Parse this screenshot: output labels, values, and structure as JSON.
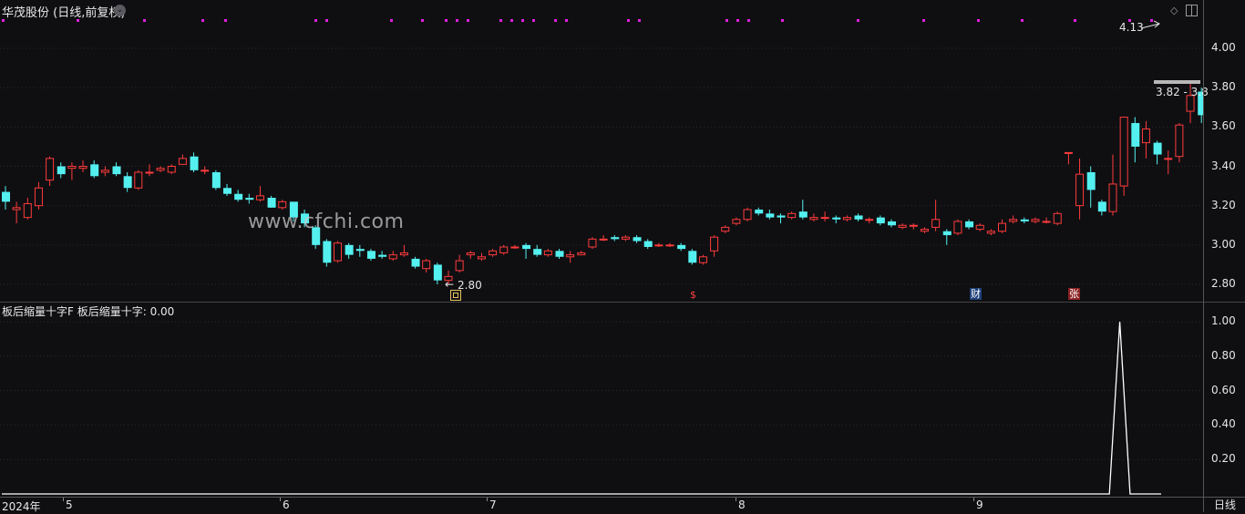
{
  "header": {
    "title": "华茂股份 (日线,前复权)",
    "dropdown_icon": "chevron-down-icon",
    "settings_icon": "diamond-icon",
    "maximize_icon": "maximize-icon"
  },
  "price_axis": {
    "ticks": [
      "4.00",
      "3.80",
      "3.60",
      "3.40",
      "3.20",
      "3.00",
      "2.80"
    ]
  },
  "indicator": {
    "title": "板后缩量十字F  板后缩量十字: 0.00",
    "axis_ticks": [
      "1.00",
      "0.80",
      "0.60",
      "0.40",
      "0.20"
    ]
  },
  "x_axis": {
    "labels": [
      "2024年",
      "5",
      "6",
      "7",
      "8",
      "9"
    ]
  },
  "period_label": "日线",
  "watermark": "www.cfchi.com",
  "annotations": {
    "high_label": "4.13",
    "low_label": "2.80",
    "range_label": "3.82 - 3.8",
    "marker_s": "$",
    "marker_cai": "财",
    "marker_zhang": "张"
  },
  "colors": {
    "up": "#ff3b3b",
    "down": "#54f0f0",
    "dots": "#e020e0",
    "background": "#0f0f12"
  },
  "chart_data": [
    {
      "type": "candlestick",
      "ylim": [
        2.74,
        4.18
      ],
      "ticks": [
        4.0,
        3.8,
        3.6,
        3.4,
        3.2,
        3.0,
        2.8
      ],
      "candles": [
        [
          3.27,
          3.22,
          3.3,
          3.18
        ],
        [
          3.18,
          3.19,
          3.22,
          3.11
        ],
        [
          3.14,
          3.21,
          3.24,
          3.13
        ],
        [
          3.2,
          3.29,
          3.32,
          3.18
        ],
        [
          3.33,
          3.44,
          3.45,
          3.3
        ],
        [
          3.4,
          3.36,
          3.42,
          3.34
        ],
        [
          3.39,
          3.4,
          3.42,
          3.33
        ],
        [
          3.39,
          3.4,
          3.43,
          3.37
        ],
        [
          3.41,
          3.35,
          3.43,
          3.34
        ],
        [
          3.37,
          3.38,
          3.4,
          3.35
        ],
        [
          3.4,
          3.36,
          3.42,
          3.35
        ],
        [
          3.35,
          3.29,
          3.37,
          3.27
        ],
        [
          3.29,
          3.37,
          3.38,
          3.28
        ],
        [
          3.37,
          3.37,
          3.41,
          3.35
        ],
        [
          3.38,
          3.39,
          3.4,
          3.37
        ],
        [
          3.37,
          3.4,
          3.41,
          3.36
        ],
        [
          3.41,
          3.44,
          3.46,
          3.41
        ],
        [
          3.45,
          3.38,
          3.47,
          3.37
        ],
        [
          3.38,
          3.38,
          3.4,
          3.36
        ],
        [
          3.37,
          3.29,
          3.38,
          3.28
        ],
        [
          3.29,
          3.26,
          3.31,
          3.25
        ],
        [
          3.26,
          3.23,
          3.28,
          3.22
        ],
        [
          3.24,
          3.23,
          3.26,
          3.21
        ],
        [
          3.23,
          3.25,
          3.3,
          3.22
        ],
        [
          3.24,
          3.19,
          3.25,
          3.19
        ],
        [
          3.19,
          3.22,
          3.23,
          3.18
        ],
        [
          3.22,
          3.14,
          3.22,
          3.12
        ],
        [
          3.16,
          3.11,
          3.18,
          3.09
        ],
        [
          3.09,
          3.0,
          3.1,
          2.98
        ],
        [
          3.02,
          2.91,
          3.03,
          2.89
        ],
        [
          2.92,
          3.01,
          3.02,
          2.91
        ],
        [
          3.0,
          2.95,
          3.01,
          2.93
        ],
        [
          2.98,
          2.97,
          3.0,
          2.94
        ],
        [
          2.97,
          2.93,
          2.98,
          2.92
        ],
        [
          2.95,
          2.94,
          2.97,
          2.93
        ],
        [
          2.93,
          2.95,
          2.97,
          2.92
        ],
        [
          2.95,
          2.96,
          3.0,
          2.94
        ],
        [
          2.93,
          2.89,
          2.94,
          2.88
        ],
        [
          2.88,
          2.92,
          2.93,
          2.86
        ],
        [
          2.9,
          2.82,
          2.91,
          2.8
        ],
        [
          2.82,
          2.84,
          2.87,
          2.8
        ],
        [
          2.87,
          2.92,
          2.95,
          2.86
        ],
        [
          2.95,
          2.96,
          2.97,
          2.93
        ],
        [
          2.93,
          2.94,
          2.96,
          2.92
        ],
        [
          2.95,
          2.97,
          2.98,
          2.94
        ],
        [
          2.96,
          2.99,
          3.0,
          2.95
        ],
        [
          2.99,
          2.99,
          3.0,
          2.98
        ],
        [
          3.0,
          2.98,
          3.01,
          2.93
        ],
        [
          2.98,
          2.95,
          3.0,
          2.94
        ],
        [
          2.95,
          2.97,
          2.98,
          2.94
        ],
        [
          2.97,
          2.94,
          2.98,
          2.93
        ],
        [
          2.94,
          2.95,
          2.97,
          2.91
        ],
        [
          2.95,
          2.96,
          2.97,
          2.95
        ],
        [
          2.99,
          3.03,
          3.04,
          2.98
        ],
        [
          3.03,
          3.03,
          3.05,
          3.02
        ],
        [
          3.04,
          3.03,
          3.05,
          3.02
        ],
        [
          3.03,
          3.04,
          3.05,
          3.02
        ],
        [
          3.04,
          3.02,
          3.05,
          3.01
        ],
        [
          3.02,
          2.99,
          3.03,
          2.98
        ],
        [
          3.0,
          3.0,
          3.01,
          2.99
        ],
        [
          3.0,
          3.0,
          3.01,
          2.99
        ],
        [
          3.0,
          2.98,
          3.01,
          2.97
        ],
        [
          2.97,
          2.91,
          2.98,
          2.9
        ],
        [
          2.91,
          2.94,
          2.95,
          2.9
        ],
        [
          2.97,
          3.04,
          3.05,
          2.94
        ],
        [
          3.07,
          3.09,
          3.1,
          3.06
        ],
        [
          3.11,
          3.13,
          3.14,
          3.1
        ],
        [
          3.13,
          3.18,
          3.19,
          3.12
        ],
        [
          3.18,
          3.16,
          3.19,
          3.15
        ],
        [
          3.16,
          3.14,
          3.18,
          3.13
        ],
        [
          3.15,
          3.14,
          3.16,
          3.11
        ],
        [
          3.14,
          3.16,
          3.17,
          3.13
        ],
        [
          3.17,
          3.14,
          3.23,
          3.13
        ],
        [
          3.13,
          3.14,
          3.16,
          3.12
        ],
        [
          3.14,
          3.14,
          3.17,
          3.12
        ],
        [
          3.14,
          3.13,
          3.15,
          3.11
        ],
        [
          3.13,
          3.14,
          3.15,
          3.12
        ],
        [
          3.15,
          3.13,
          3.16,
          3.12
        ],
        [
          3.13,
          3.13,
          3.14,
          3.11
        ],
        [
          3.14,
          3.11,
          3.15,
          3.1
        ],
        [
          3.12,
          3.1,
          3.13,
          3.09
        ],
        [
          3.09,
          3.1,
          3.11,
          3.08
        ],
        [
          3.1,
          3.1,
          3.11,
          3.08
        ],
        [
          3.07,
          3.08,
          3.09,
          3.06
        ],
        [
          3.09,
          3.13,
          3.23,
          3.07
        ],
        [
          3.07,
          3.05,
          3.08,
          3.0
        ],
        [
          3.06,
          3.12,
          3.13,
          3.05
        ],
        [
          3.12,
          3.09,
          3.13,
          3.08
        ],
        [
          3.08,
          3.1,
          3.11,
          3.07
        ],
        [
          3.06,
          3.07,
          3.08,
          3.05
        ],
        [
          3.07,
          3.11,
          3.13,
          3.06
        ],
        [
          3.12,
          3.13,
          3.15,
          3.11
        ],
        [
          3.13,
          3.12,
          3.14,
          3.11
        ],
        [
          3.12,
          3.13,
          3.14,
          3.11
        ],
        [
          3.12,
          3.12,
          3.14,
          3.11
        ],
        [
          3.11,
          3.16,
          3.17,
          3.1
        ],
        [
          3.47,
          3.47,
          3.47,
          3.41
        ],
        [
          3.2,
          3.36,
          3.44,
          3.13
        ],
        [
          3.37,
          3.28,
          3.4,
          3.19
        ],
        [
          3.22,
          3.17,
          3.23,
          3.15
        ],
        [
          3.17,
          3.31,
          3.46,
          3.15
        ],
        [
          3.3,
          3.65,
          3.65,
          3.25
        ],
        [
          3.62,
          3.5,
          3.65,
          3.42
        ],
        [
          3.52,
          3.59,
          3.63,
          3.44
        ],
        [
          3.52,
          3.46,
          3.53,
          3.41
        ],
        [
          3.44,
          3.44,
          3.48,
          3.36
        ],
        [
          3.45,
          3.61,
          3.62,
          3.42
        ],
        [
          3.68,
          3.76,
          3.83,
          3.62
        ],
        [
          3.78,
          3.66,
          3.8,
          3.62
        ],
        [
          3.84,
          3.88,
          4.13,
          3.82
        ]
      ]
    },
    {
      "type": "line",
      "series": [
        {
          "values": [
            0,
            0,
            0,
            0,
            0,
            0,
            0,
            0,
            0,
            0,
            0,
            0,
            0,
            0,
            0,
            0,
            0,
            0,
            0,
            0,
            0,
            0,
            0,
            0,
            0,
            0,
            0,
            0,
            0,
            0,
            0,
            0,
            0,
            0,
            0,
            0,
            0,
            0,
            0,
            0,
            0,
            0,
            0,
            0,
            0,
            0,
            0,
            0,
            0,
            0,
            0,
            0,
            0,
            0,
            0,
            0,
            0,
            0,
            0,
            0,
            0,
            0,
            0,
            0,
            0,
            0,
            0,
            0,
            0,
            0,
            0,
            0,
            0,
            0,
            0,
            0,
            0,
            0,
            0,
            0,
            0,
            0,
            0,
            0,
            0,
            0,
            0,
            0,
            0,
            0,
            0,
            0,
            0,
            0,
            0,
            0,
            0,
            0,
            0,
            0,
            0,
            0,
            0,
            0,
            0,
            0,
            0,
            0,
            1,
            0,
            0,
            0,
            0
          ]
        }
      ],
      "ylim": [
        0,
        1.05
      ],
      "ticks": [
        1.0,
        0.8,
        0.6,
        0.4,
        0.2
      ]
    }
  ]
}
